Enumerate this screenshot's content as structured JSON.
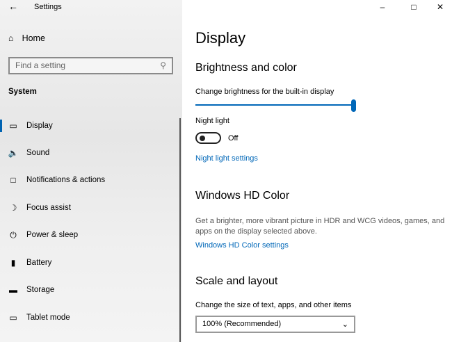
{
  "window": {
    "title": "Settings"
  },
  "sidebar": {
    "home": "Home",
    "search_placeholder": "Find a setting",
    "section": "System",
    "items": [
      {
        "label": "Display",
        "icon": "monitor-icon"
      },
      {
        "label": "Sound",
        "icon": "speaker-icon"
      },
      {
        "label": "Notifications & actions",
        "icon": "notification-icon"
      },
      {
        "label": "Focus assist",
        "icon": "moon-icon"
      },
      {
        "label": "Power & sleep",
        "icon": "power-icon"
      },
      {
        "label": "Battery",
        "icon": "battery-icon"
      },
      {
        "label": "Storage",
        "icon": "storage-icon"
      },
      {
        "label": "Tablet mode",
        "icon": "tablet-icon"
      }
    ]
  },
  "main": {
    "title": "Display",
    "brightness": {
      "heading": "Brightness and color",
      "label": "Change brightness for the built-in display",
      "value_percent": 100,
      "night_light_label": "Night light",
      "night_light_state": "Off",
      "night_light_link": "Night light settings"
    },
    "hdr": {
      "heading": "Windows HD Color",
      "description": "Get a brighter, more vibrant picture in HDR and WCG videos, games, and apps on the display selected above.",
      "link": "Windows HD Color settings"
    },
    "scale": {
      "heading": "Scale and layout",
      "label": "Change the size of text, apps, and other items",
      "value": "100% (Recommended)"
    }
  }
}
